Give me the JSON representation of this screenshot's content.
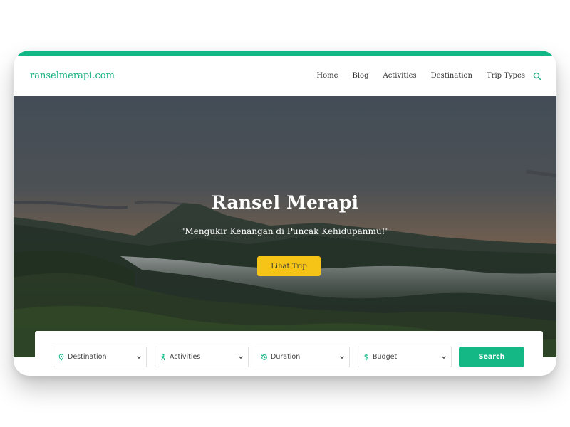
{
  "brand": {
    "name": "ranselmerapi.com",
    "accent": "#11b784"
  },
  "nav": {
    "items": [
      "Home",
      "Blog",
      "Activities",
      "Destination",
      "Trip Types"
    ],
    "search_icon": "search-icon"
  },
  "hero": {
    "title": "Ransel Merapi",
    "subtitle": "\"Mengukir Kenangan di Puncak Kehidupanmu!\"",
    "cta_label": "Lihat Trip",
    "cta_color": "#f6c417"
  },
  "search": {
    "fields": [
      {
        "label": "Destination",
        "icon": "map-pin-icon"
      },
      {
        "label": "Activities",
        "icon": "hiker-icon"
      },
      {
        "label": "Duration",
        "icon": "history-icon"
      },
      {
        "label": "Budget",
        "icon": "dollar-icon"
      }
    ],
    "button_label": "Search"
  }
}
